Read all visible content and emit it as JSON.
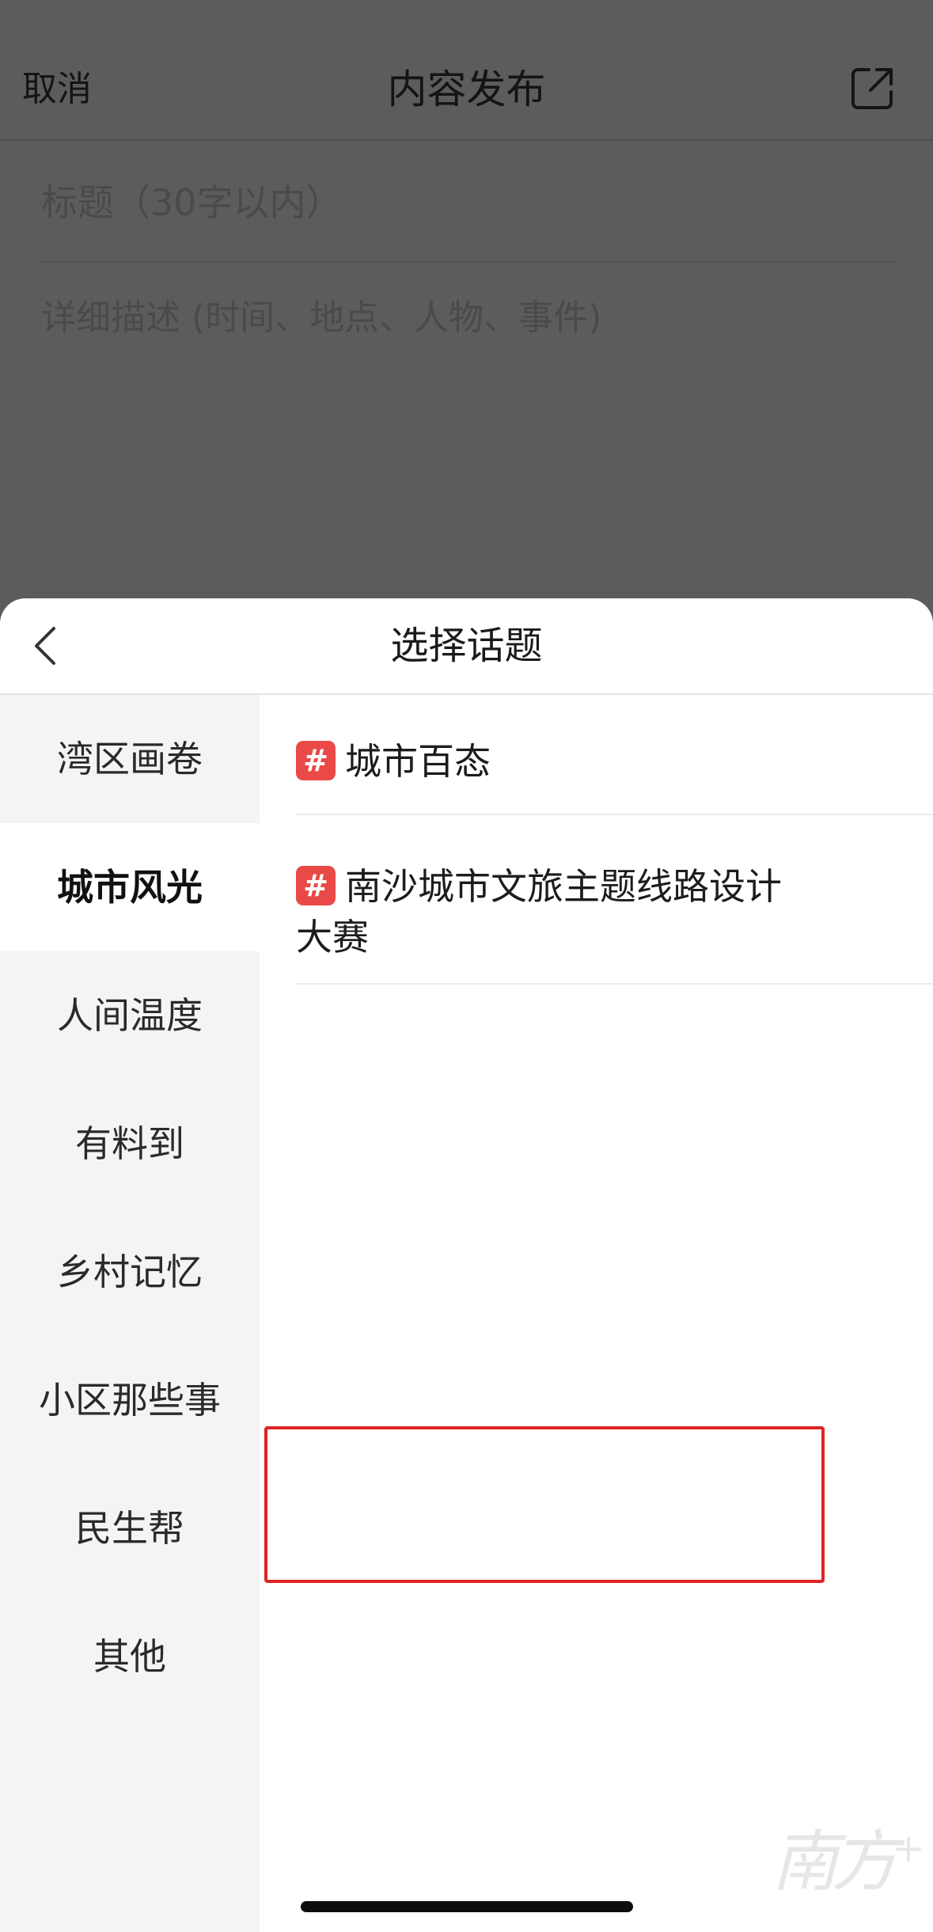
{
  "compose": {
    "cancel_label": "取消",
    "title": "内容发布",
    "share_icon": "share-external-icon",
    "title_placeholder": "标题（30字以内）",
    "description_placeholder": "详细描述 (时间、地点、人物、事件)"
  },
  "sheet": {
    "back_icon": "chevron-left-icon",
    "title": "选择话题",
    "categories": [
      {
        "label": "湾区画卷",
        "active": false
      },
      {
        "label": "城市风光",
        "active": true
      },
      {
        "label": "人间温度",
        "active": false
      },
      {
        "label": "有料到",
        "active": false
      },
      {
        "label": "乡村记忆",
        "active": false
      },
      {
        "label": "小区那些事",
        "active": false
      },
      {
        "label": "民生帮",
        "active": false
      },
      {
        "label": "其他",
        "active": false
      }
    ],
    "topics": [
      {
        "hash": "#",
        "label": "城市百态"
      },
      {
        "hash": "#",
        "label": "南沙城市文旅主题线路设计大赛"
      }
    ],
    "highlight_color": "#e02424",
    "hash_badge_color": "#e94a47"
  },
  "watermark": {
    "text": "南方",
    "suffix": "+"
  }
}
